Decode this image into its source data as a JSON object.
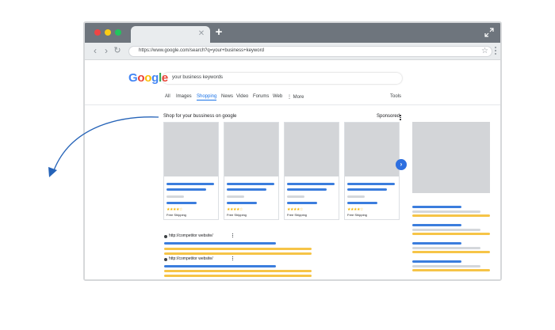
{
  "browser": {
    "tab": {
      "close_label": "✕"
    },
    "new_tab_label": "+",
    "url": "https://www.google.com/search?q=your+business+keyword",
    "colors": {
      "chrome": "#6e757d",
      "toolbar": "#e9ecee"
    }
  },
  "google": {
    "logo_letters": [
      {
        "char": "G",
        "color": "#4285f4"
      },
      {
        "char": "o",
        "color": "#ea4335"
      },
      {
        "char": "o",
        "color": "#fbbc05"
      },
      {
        "char": "g",
        "color": "#4285f4"
      },
      {
        "char": "l",
        "color": "#34a853"
      },
      {
        "char": "e",
        "color": "#ea4335"
      }
    ],
    "search_query": "your business keywords",
    "tabs": [
      "All",
      "Images",
      "Shopping",
      "News",
      "Video",
      "Forums",
      "Web",
      "⋮ More"
    ],
    "active_tab": "Shopping",
    "tools_label": "Tools"
  },
  "shopping": {
    "title": "Shop for your bussiness on google",
    "sponsored_label": "Sponsored",
    "cards": [
      {
        "rating": "★★★★☆",
        "shipping": "Free Shipping"
      },
      {
        "rating": "★★★★☆",
        "shipping": "Free Shipping"
      },
      {
        "rating": "★★★★☆",
        "shipping": "Free Shipping"
      },
      {
        "rating": "★★★★☆",
        "shipping": "Free Shipping"
      }
    ],
    "next_icon": "chevron-right-icon",
    "colors": {
      "accent": "#3b7ddd",
      "highlight": "#f6c447",
      "placeholder": "#d3d5d8"
    }
  },
  "results": [
    {
      "url": "http://competitor website/"
    },
    {
      "url": "http://competitor website/"
    }
  ]
}
